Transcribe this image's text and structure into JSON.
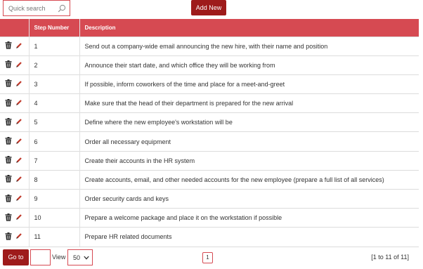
{
  "toolbar": {
    "search_placeholder": "Quick search",
    "add_label": "Add New"
  },
  "icons": {
    "search": "search-icon",
    "delete": "trash-icon",
    "edit": "pencil-icon",
    "dropdown": "chevron-down-icon"
  },
  "colors": {
    "header_bg": "#d64a52",
    "button_bg": "#9e1b1b",
    "border_accent": "#d64a52",
    "edit_icon": "#c0392b"
  },
  "table": {
    "columns": [
      "",
      "Step Number",
      "Description"
    ],
    "rows": [
      {
        "step": "1",
        "description": "Send out a company-wide email announcing the new hire, with their name and position"
      },
      {
        "step": "2",
        "description": "Announce their start date, and which office they will be working from"
      },
      {
        "step": "3",
        "description": "If possible, inform coworkers of the time and place for a meet-and-greet"
      },
      {
        "step": "4",
        "description": "Make sure that the head of their department is prepared for the new arrival"
      },
      {
        "step": "5",
        "description": "Define where the new employee's workstation will be"
      },
      {
        "step": "6",
        "description": "Order all necessary equipment"
      },
      {
        "step": "7",
        "description": "Create their accounts in the HR system"
      },
      {
        "step": "8",
        "description": "Create accounts, email, and other needed accounts for the new employee (prepare a full list of all services)"
      },
      {
        "step": "9",
        "description": "Order security cards and keys"
      },
      {
        "step": "10",
        "description": "Prepare a welcome package and place it on the workstation if possible"
      },
      {
        "step": "11",
        "description": "Prepare HR related documents"
      }
    ]
  },
  "footer": {
    "goto_label": "Go to",
    "goto_value": "",
    "view_label": "View",
    "page_size": "50",
    "current_page": "1",
    "range_text": "[1 to 11 of 11]"
  }
}
